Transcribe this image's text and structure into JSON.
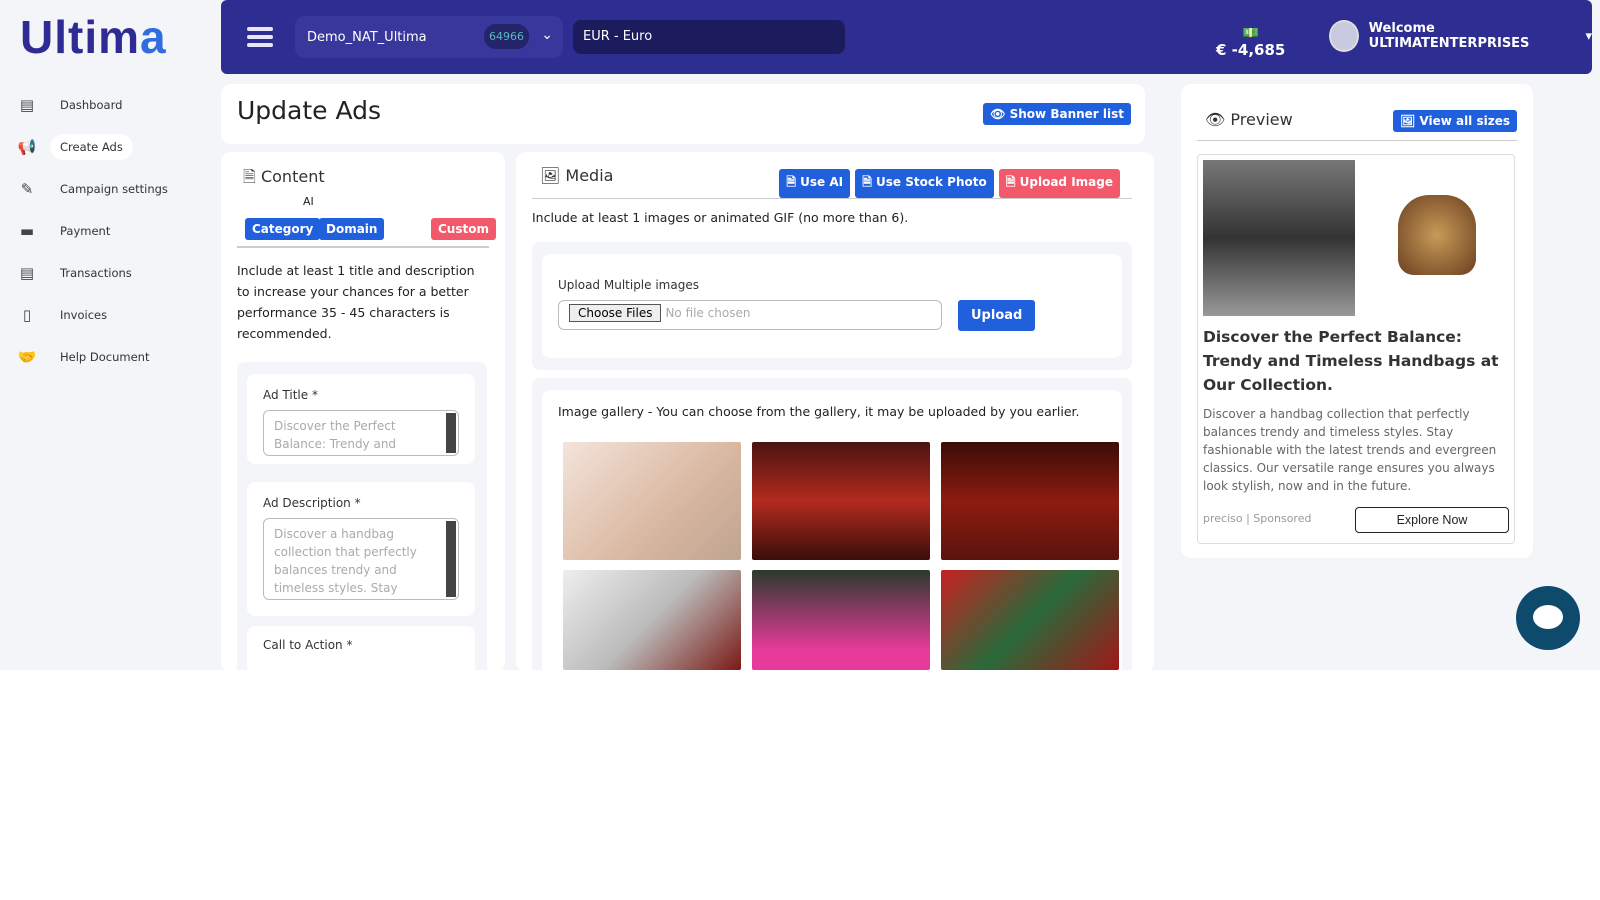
{
  "logo": "Ultima",
  "sidebar": {
    "items": [
      {
        "label": "Dashboard",
        "icon": "document-icon"
      },
      {
        "label": "Create Ads",
        "icon": "megaphone-icon"
      },
      {
        "label": "Campaign settings",
        "icon": "edit-icon"
      },
      {
        "label": "Payment",
        "icon": "paypal-icon"
      },
      {
        "label": "Transactions",
        "icon": "document-icon"
      },
      {
        "label": "Invoices",
        "icon": "pdf-icon"
      },
      {
        "label": "Help Document",
        "icon": "handshake-icon"
      }
    ]
  },
  "header": {
    "account": "Demo_NAT_Ultima",
    "account_id": "64966",
    "currency": "EUR - Euro",
    "balance": "€ -4,685",
    "welcome": "Welcome ULTIMATENTERPRISES"
  },
  "page": {
    "title": "Update Ads",
    "show_banner": "Show Banner list"
  },
  "content": {
    "title": "Content",
    "ai": "AI",
    "category": "Category",
    "domain": "Domain",
    "custom": "Custom",
    "help": "Include at least 1 title and description to increase your chances for a better performance 35 - 45 characters is recommended.",
    "ad_title_label": "Ad Title *",
    "ad_title": "Discover the Perfect Balance: Trendy and",
    "ad_desc_label": "Ad Description *",
    "ad_desc": "Discover a handbag collection that perfectly balances trendy and timeless styles. Stay",
    "cta_label": "Call to Action *"
  },
  "media": {
    "title": "Media",
    "use_ai": "Use AI",
    "stock": "Use Stock Photo",
    "upload_image": "Upload Image",
    "note": "Include at least 1 images or animated GIF (no more than 6).",
    "upload_label": "Upload Multiple images",
    "choose": "Choose Files",
    "no_file": "No file chosen",
    "upload": "Upload",
    "gallery_note": "Image gallery - You can choose from the gallery, it may be uploaded by you earlier."
  },
  "preview": {
    "title": "Preview",
    "view_all": "View all sizes",
    "headline": "Discover the Perfect Balance: Trendy and Timeless Handbags at Our Collection.",
    "body": "Discover a handbag collection that perfectly balances trendy and timeless styles. Stay fashionable with the latest trends and evergreen classics. Our versatile range ensures you always look stylish, now and in the future.",
    "sponsor": "preciso | Sponsored",
    "cta": "Explore Now"
  }
}
